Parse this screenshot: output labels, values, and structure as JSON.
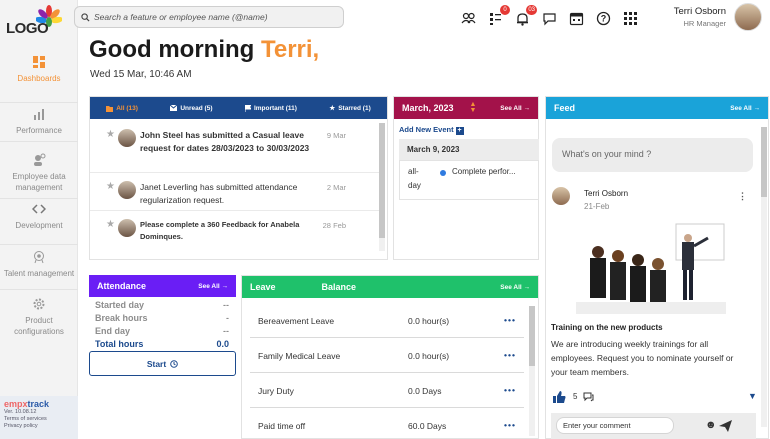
{
  "logo": {
    "text": "LOGO"
  },
  "sidebar": {
    "items": [
      {
        "label": "Dashboards",
        "icon": "dashboard-icon"
      },
      {
        "label": "Performance",
        "icon": "bar-chart-icon"
      },
      {
        "label": "Employee data management",
        "icon": "people-settings-icon"
      },
      {
        "label": "Development",
        "icon": "code-icon"
      },
      {
        "label": "Talent management",
        "icon": "talent-icon"
      },
      {
        "label": "Product configurations",
        "icon": "gear-icon"
      }
    ],
    "footer": {
      "brand_a": "empx",
      "brand_b": "track",
      "version": "Ver. 10.08.12",
      "terms": "Terms of services",
      "privacy": "Privacy policy"
    }
  },
  "search": {
    "placeholder": "Search a feature or employee name (@name)"
  },
  "topbar": {
    "badges": {
      "tasks": "0",
      "notifications": "03"
    }
  },
  "user": {
    "name": "Terri Osborn",
    "role": "HR Manager"
  },
  "greeting": {
    "prefix": "Good morning",
    "name": "Terri,",
    "date": "Wed 15 Mar, 10:46 AM"
  },
  "notifications": {
    "tabs": [
      {
        "label": "All (13)",
        "active": true
      },
      {
        "label": "Unread (5)",
        "active": false
      },
      {
        "label": "Important (11)",
        "active": false
      },
      {
        "label": "Starred (1)",
        "active": false
      }
    ],
    "items": [
      {
        "text": "John Steel has submitted a Casual leave request for dates 28/03/2023 to 30/03/2023",
        "when": "9 Mar"
      },
      {
        "text": "Janet Leverling has submitted attendance regularization request.",
        "when": "2 Mar"
      },
      {
        "text": "Please complete a 360 Feedback for Anabela Dominques.",
        "when": "28 Feb"
      }
    ]
  },
  "calendar": {
    "month": "March, 2023",
    "see_all": "See All →",
    "add_event": "Add New Event",
    "day_heading": "March 9, 2023",
    "event": {
      "time_a": "all-",
      "time_b": "day",
      "title": "Complete perfor..."
    }
  },
  "feed": {
    "title": "Feed",
    "see_all": "See All →",
    "mind_placeholder": "What's on your mind ?",
    "post": {
      "author": "Terri Osborn",
      "date": "21-Feb",
      "title": "Training on the new products",
      "body": "We are introducing weekly trainings for all employees. Request you to nominate yourself or your team members.",
      "likes": "5"
    },
    "comment_placeholder": "Enter your comment"
  },
  "attendance": {
    "title": "Attendance",
    "see_all": "See All →",
    "rows": [
      {
        "label": "Started day",
        "value": "--"
      },
      {
        "label": "Break hours",
        "value": "-"
      },
      {
        "label": "End day",
        "value": "--"
      },
      {
        "label": "Total hours",
        "value": "0.0"
      }
    ],
    "start_label": "Start"
  },
  "leave": {
    "title_a": "Leave",
    "title_b": "Balance",
    "see_all": "See All →",
    "rows": [
      {
        "name": "Bereavement Leave",
        "balance": "0.0 hour(s)"
      },
      {
        "name": "Family Medical Leave",
        "balance": "0.0 hour(s)"
      },
      {
        "name": "Jury Duty",
        "balance": "0.0 Days"
      },
      {
        "name": "Paid time off",
        "balance": "60.0 Days"
      }
    ]
  },
  "colors": {
    "accent": "#f39237",
    "notifications": "#1c4a8d",
    "calendar": "#a3124a",
    "feed": "#1aa3d9",
    "attendance": "#6a1ef5",
    "leave": "#1fc16b"
  }
}
